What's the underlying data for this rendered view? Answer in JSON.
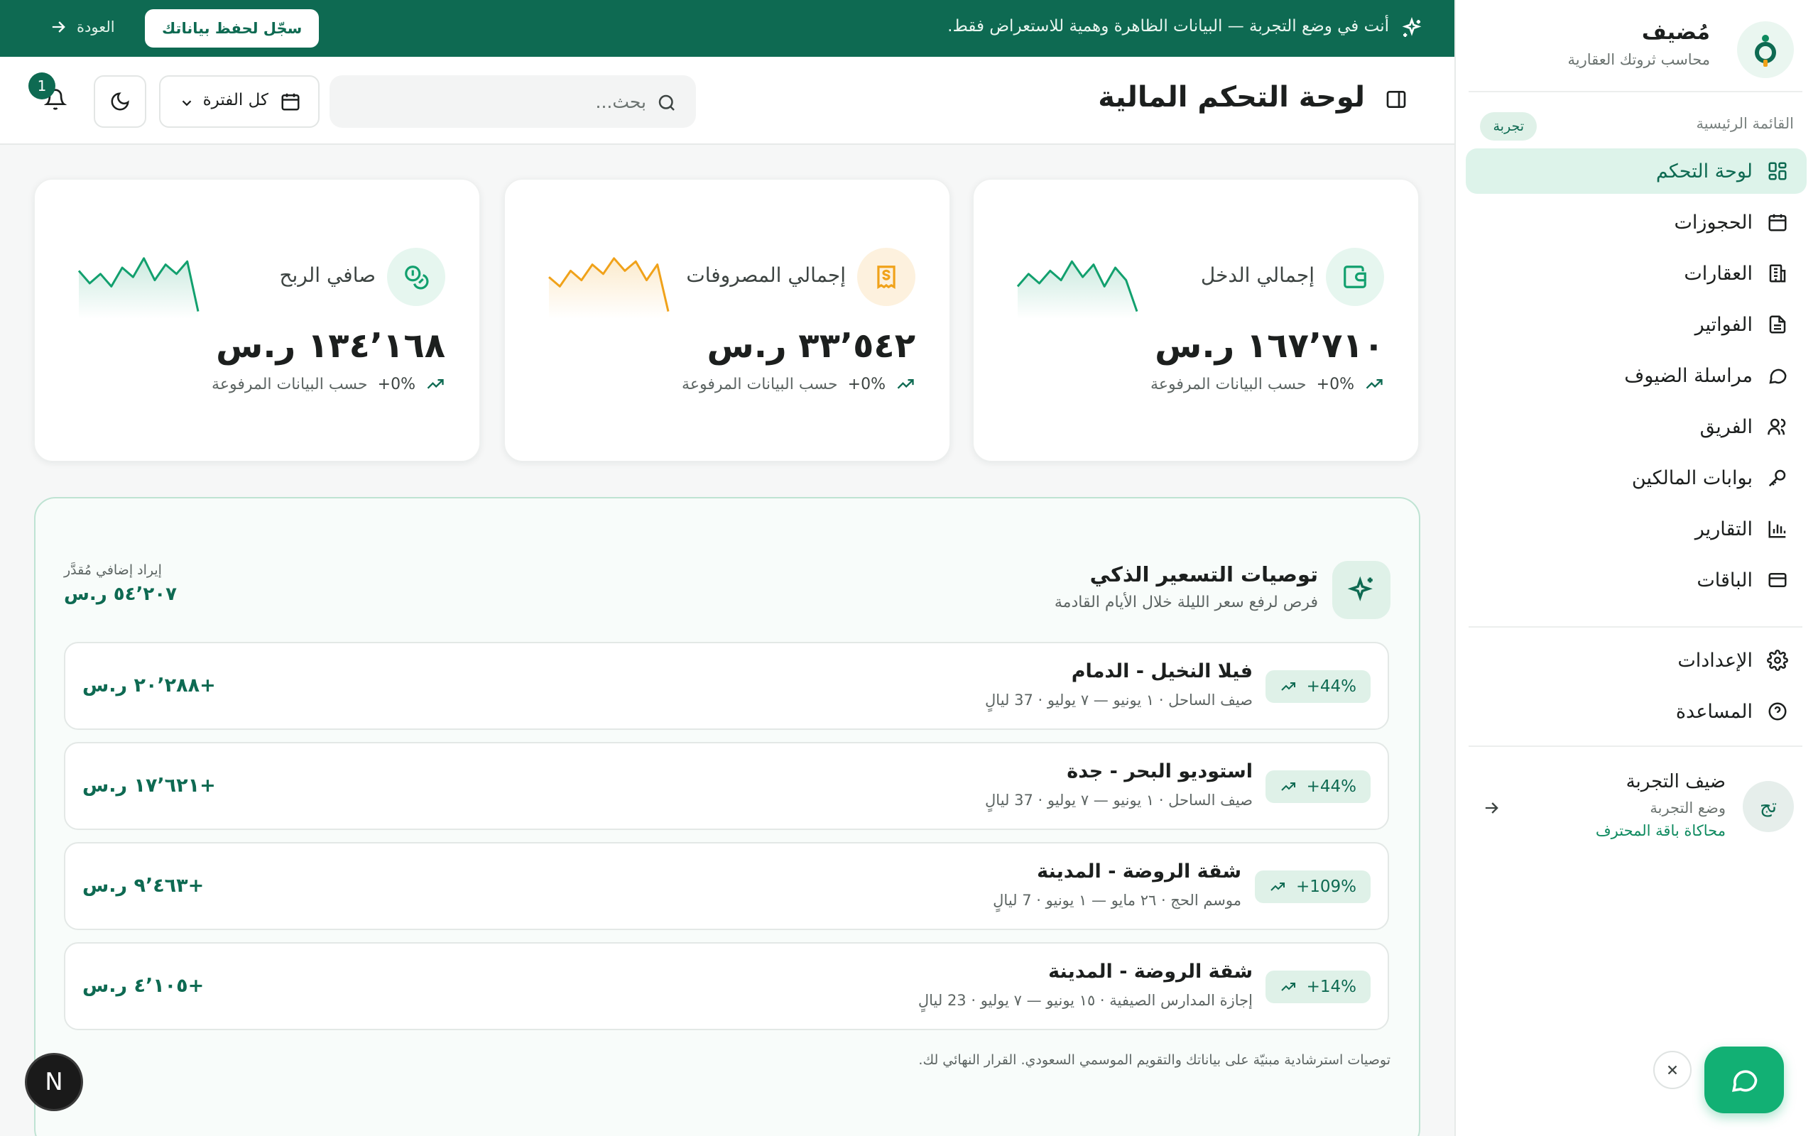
{
  "banner": {
    "message": "أنت في وضع التجربة — البيانات الظاهرة وهمية للاستعراض فقط.",
    "cta_label": "سجّل لحفظ بياناتك",
    "back_label": "العودة"
  },
  "brand": {
    "name": "مُضيف",
    "tagline": "محاسب ثروتك العقارية"
  },
  "sidebar": {
    "section_label": "القائمة الرئيسية",
    "trial_badge": "تجربة",
    "items": [
      {
        "label": "لوحة التحكم",
        "icon": "dashboard-icon",
        "active": true
      },
      {
        "label": "الحجوزات",
        "icon": "calendar-icon"
      },
      {
        "label": "العقارات",
        "icon": "building-icon"
      },
      {
        "label": "الفواتير",
        "icon": "invoice-icon"
      },
      {
        "label": "مراسلة الضيوف",
        "icon": "chat-icon"
      },
      {
        "label": "الفريق",
        "icon": "team-icon"
      },
      {
        "label": "بوابات المالكين",
        "icon": "key-icon"
      },
      {
        "label": "التقارير",
        "icon": "bar-chart-icon"
      },
      {
        "label": "الباقات",
        "icon": "card-icon"
      }
    ],
    "footer_items": [
      {
        "label": "الإعدادات",
        "icon": "gear-icon"
      },
      {
        "label": "المساعدة",
        "icon": "help-icon"
      }
    ],
    "user": {
      "initials": "تج",
      "name": "ضيف التجربة",
      "mode": "وضع التجربة",
      "plan": "محاكاة باقة المحترف"
    }
  },
  "header": {
    "title": "لوحة التحكم المالية",
    "search_placeholder": "بحث...",
    "period_label": "كل الفترة",
    "notification_count": "1"
  },
  "kpis": [
    {
      "title": "إجمالي الدخل",
      "value": "١٦٧٬٧١٠ ر.س",
      "trend": "+0%",
      "note": "حسب البيانات المرفوعة",
      "color": "#12a06e",
      "icon": "wallet-icon",
      "spark": [
        0.55,
        0.35,
        0.5,
        0.3,
        0.45,
        0.15,
        0.4,
        0.2,
        0.55,
        0.25,
        0.45,
        0.95
      ]
    },
    {
      "title": "إجمالي المصروفات",
      "value": "٣٣٬٥٤٢ ر.س",
      "trend": "+0%",
      "note": "حسب البيانات المرفوعة",
      "color": "#f0a21a",
      "icon": "receipt-icon",
      "spark": [
        0.4,
        0.55,
        0.3,
        0.45,
        0.2,
        0.35,
        0.1,
        0.3,
        0.15,
        0.45,
        0.2,
        0.95
      ]
    },
    {
      "title": "صافي الربح",
      "value": "١٣٤٬١٦٨ ر.س",
      "trend": "+0%",
      "note": "حسب البيانات المرفوعة",
      "color": "#12a06e",
      "icon": "coins-icon",
      "spark": [
        0.3,
        0.5,
        0.35,
        0.55,
        0.25,
        0.4,
        0.1,
        0.45,
        0.2,
        0.35,
        0.15,
        0.95
      ]
    }
  ],
  "pricing": {
    "title": "توصيات التسعير الذكي",
    "subtitle": "فرص لرفع سعر الليلة خلال الأيام القادمة",
    "extra_label": "إيراد إضافي مُقدَّر",
    "extra_value": "٥٤٬٢٠٧ ر.س",
    "recommendations": [
      {
        "name": "فيلا النخيل - الدمام",
        "detail": "صيف الساحل · ١ يونيو — ٧ يوليو · 37 ليالٍ",
        "badge": "+44%",
        "gain": "+٢٠٬٢٨٨ ر.س"
      },
      {
        "name": "استوديو البحر - جدة",
        "detail": "صيف الساحل · ١ يونيو — ٧ يوليو · 37 ليالٍ",
        "badge": "+44%",
        "gain": "+١٧٬٦٢١ ر.س"
      },
      {
        "name": "شقة الروضة - المدينة",
        "detail": "موسم الحج · ٢٦ مايو — ١ يونيو · 7 ليالٍ",
        "badge": "+109%",
        "gain": "+٩٬٤٦٣ ر.س"
      },
      {
        "name": "شقة الروضة - المدينة",
        "detail": "إجازة المدارس الصيفية · ١٥ يونيو — ٧ يوليو · 23 ليالٍ",
        "badge": "+14%",
        "gain": "+٤٬١٠٥ ر.س"
      }
    ],
    "footnote": "توصيات استرشادية مبنيّة على بياناتك والتقويم الموسمي السعودي. القرار النهائي لك."
  },
  "floating": {
    "dev_badge": "N"
  },
  "colors": {
    "primary": "#0e6a52",
    "accent": "#12b074",
    "expense": "#f0a21a"
  }
}
